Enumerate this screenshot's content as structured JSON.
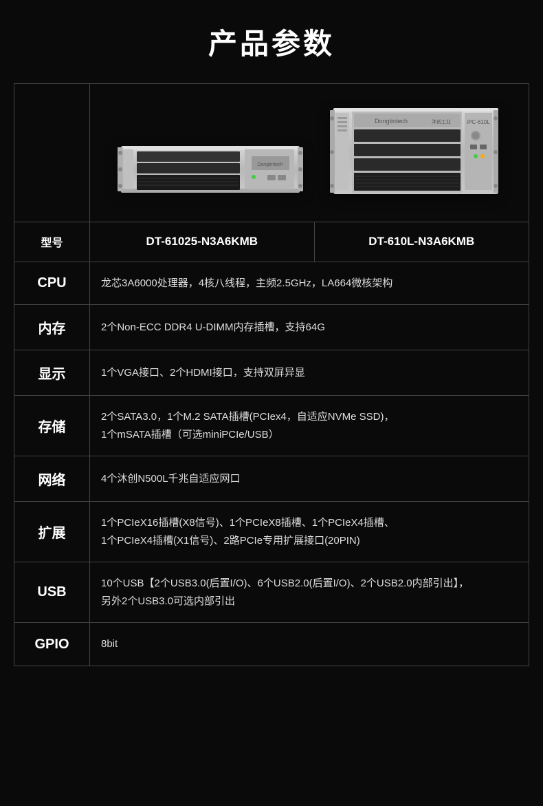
{
  "page": {
    "title": "产品参数",
    "bg_color": "#0a0a0a"
  },
  "header": {
    "model_label": "型号",
    "model_1": "DT-61025-N3A6KMB",
    "model_2": "DT-610L-N3A6KMB"
  },
  "specs": [
    {
      "label": "CPU",
      "value": "龙芯3A6000处理器，4核八线程，主频2.5GHz，LA664微核架构"
    },
    {
      "label": "内存",
      "value": "2个Non-ECC DDR4 U-DIMM内存插槽，支持64G"
    },
    {
      "label": "显示",
      "value": "1个VGA接口、2个HDMI接口，支持双屏异显"
    },
    {
      "label": "存储",
      "value": "2个SATA3.0，1个M.2 SATA插槽(PCIex4，自适应NVMe SSD)，\n1个mSATA插槽（可选miniPCIe/USB）"
    },
    {
      "label": "网络",
      "value": "4个沐创N500L千兆自适应网口"
    },
    {
      "label": "扩展",
      "value": "1个PCIeX16插槽(X8信号)、1个PCIeX8插槽、1个PCIeX4插槽、\n1个PCIeX4插槽(X1信号)、2路PCIe专用扩展接口(20PIN)"
    },
    {
      "label": "USB",
      "value": "10个USB【2个USB3.0(后置I/O)、6个USB2.0(后置I/O)、2个USB2.0内部引出】，\n另外2个USB3.0可选内部引出"
    },
    {
      "label": "GPIO",
      "value": "8bit"
    }
  ]
}
